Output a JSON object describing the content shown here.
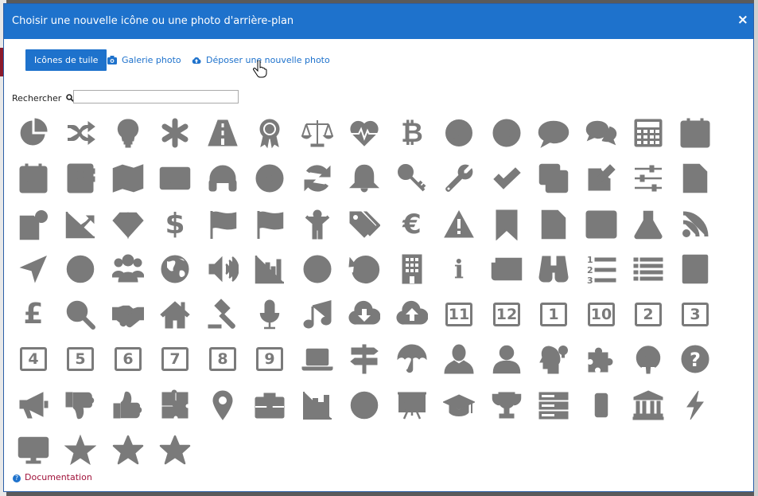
{
  "dialog": {
    "title": "Choisir une nouvelle icône ou une photo d'arrière-plan",
    "close_label": "×"
  },
  "tabs": [
    {
      "label": "Icônes de tuile",
      "active": true
    },
    {
      "label": "Galerie photo",
      "icon": "camera-icon"
    },
    {
      "label": "Déposer une nouvelle photo",
      "icon": "cloud-upload-icon"
    }
  ],
  "search": {
    "label": "Rechercher",
    "value": "",
    "placeholder": ""
  },
  "icons": [
    "pie-chart-icon",
    "shuffle-icon",
    "lightbulb-icon",
    "asterisk-icon",
    "road-icon",
    "award-icon",
    "balance-scale-icon",
    "heartbeat-icon",
    "bitcoin-icon",
    "compass-icon",
    "life-ring-icon",
    "comment-icon",
    "comments-icon",
    "calculator-icon",
    "calendar-icon",
    "calendar-check-icon",
    "address-book-icon",
    "map-icon",
    "id-card-icon",
    "headphones-icon",
    "bullseye-icon",
    "refresh-icon",
    "bell-icon",
    "key-icon",
    "wrench-icon",
    "check-icon",
    "clone-icon",
    "edit-icon",
    "sliders-icon",
    "grade-file-icon",
    "file-clock-icon",
    "line-chart-icon",
    "diamond-icon",
    "dollar-icon",
    "flag-outline-icon",
    "flag-checkered-icon",
    "child-icon",
    "tags-icon",
    "euro-icon",
    "warning-icon",
    "bookmark-icon",
    "file-text-icon",
    "film-icon",
    "flask-icon",
    "rss-icon",
    "location-arrow-icon",
    "frown-icon",
    "users-icon",
    "globe-icon",
    "volume-up-icon",
    "bar-chart-icon",
    "clock-icon",
    "history-icon",
    "building-icon",
    "info-icon",
    "newspaper-icon",
    "binoculars-icon",
    "list-ordered-icon",
    "list-icon",
    "notebook-icon",
    "pound-icon",
    "search-icon",
    "handshake-icon",
    "home-icon",
    "gavel-icon",
    "microphone-icon",
    "music-icon",
    "cloud-download-icon",
    "cloud-upload-icon",
    "number-11-icon",
    "number-12-icon",
    "number-1-icon",
    "number-10-icon",
    "number-2-icon",
    "number-3-icon",
    "number-4-icon",
    "number-5-icon",
    "number-6-icon",
    "number-7-icon",
    "number-8-icon",
    "number-9-icon",
    "laptop-icon",
    "signpost-icon",
    "umbrella-icon",
    "user-icon",
    "user-outline-icon",
    "user-idea-icon",
    "puzzle-piece-icon",
    "podcast-icon",
    "question-circle-icon",
    "bullhorn-icon",
    "thumbs-down-icon",
    "thumbs-up-icon",
    "puzzle-icon",
    "map-marker-icon",
    "briefcase-icon",
    "bar-chart-outline-icon",
    "smile-icon",
    "presentation-icon",
    "graduation-cap-icon",
    "trophy-icon",
    "server-icon",
    "mobile-icon",
    "university-icon",
    "bolt-icon",
    "desktop-icon",
    "star-icon",
    "star-outline-icon",
    "star-half-icon"
  ],
  "number_labels": {
    "n11": "11",
    "n12": "12",
    "n1": "1",
    "n10": "10",
    "n2": "2",
    "n3": "3",
    "n4": "4",
    "n5": "5",
    "n6": "6",
    "n7": "7",
    "n8": "8",
    "n9": "9"
  },
  "glyph_labels": {
    "bitcoin": "₿",
    "dollar": "$",
    "euro": "€",
    "pound": "£",
    "info": "i",
    "question": "?"
  },
  "footer": {
    "doc_label": "Documentation"
  },
  "colors": {
    "header": "#1e72cc",
    "icon": "#7a7a7a",
    "doc_link": "#a0123a"
  }
}
